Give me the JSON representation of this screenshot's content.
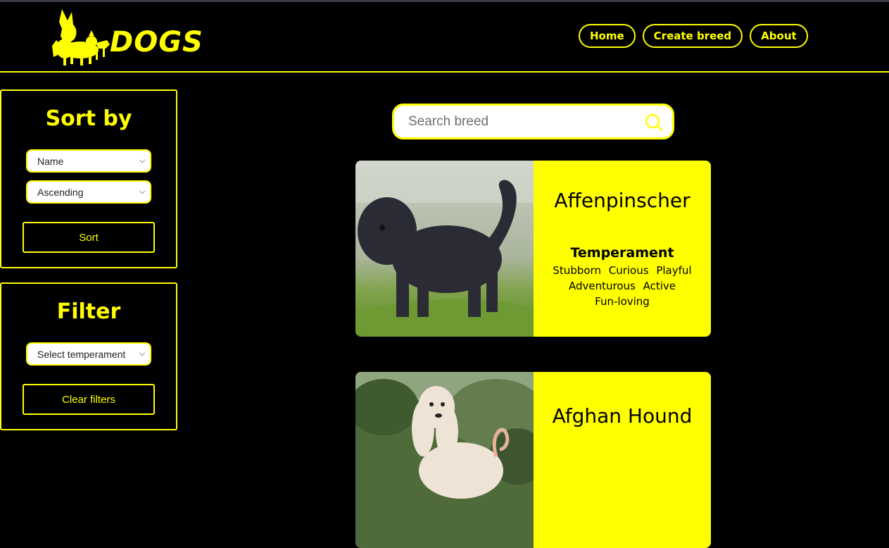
{
  "header": {
    "logo_text": "DOGS",
    "nav": [
      "Home",
      "Create breed",
      "About"
    ]
  },
  "sort_panel": {
    "title": "Sort by",
    "field_select": "Name",
    "order_select": "Ascending",
    "button": "Sort"
  },
  "filter_panel": {
    "title": "Filter",
    "temperament_select": "Select temperament",
    "button": "Clear filters"
  },
  "search": {
    "placeholder": "Search breed"
  },
  "breeds": [
    {
      "name": "Affenpinscher",
      "temperament_label": "Temperament",
      "temperaments": [
        "Stubborn",
        "Curious",
        "Playful",
        "Adventurous",
        "Active",
        "Fun-loving"
      ]
    },
    {
      "name": "Afghan Hound"
    }
  ],
  "colors": {
    "accent": "#ffff00",
    "background": "#000000"
  }
}
